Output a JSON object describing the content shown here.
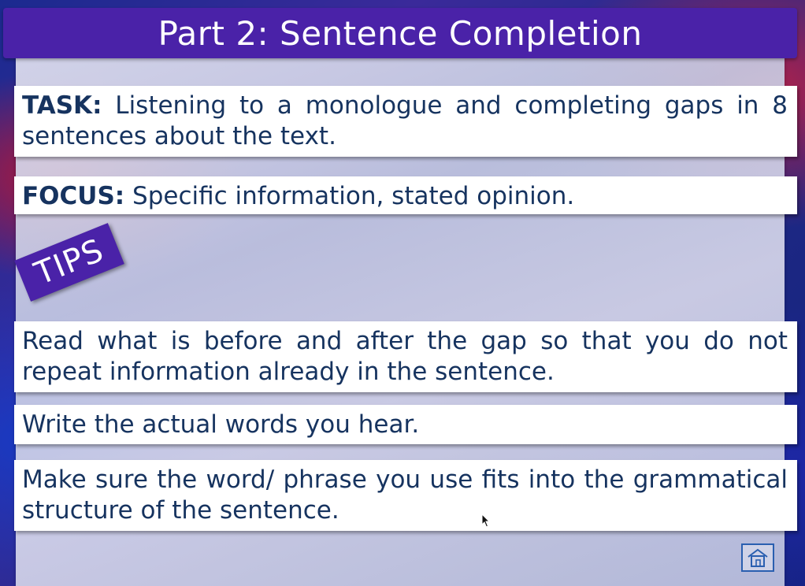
{
  "title": "Part 2: Sentence Completion",
  "task": {
    "label": "TASK:",
    "text": " Listening to a monologue and completing gaps in 8 sentences about the text."
  },
  "focus": {
    "label": "FOCUS:",
    "text": " Specific information, stated opinion."
  },
  "tips_badge": "TIPS",
  "tips": [
    "Read what is before and after the gap so that you do not repeat information already in the sentence.",
    "Write the actual words you hear.",
    "Make sure the word/ phrase you use fits into the grammatical structure of the sentence."
  ],
  "home_button": {
    "icon": "home-icon"
  },
  "colors": {
    "accent": "#4a22a8",
    "text": "#16335f",
    "home_border": "#2a5fb0"
  }
}
